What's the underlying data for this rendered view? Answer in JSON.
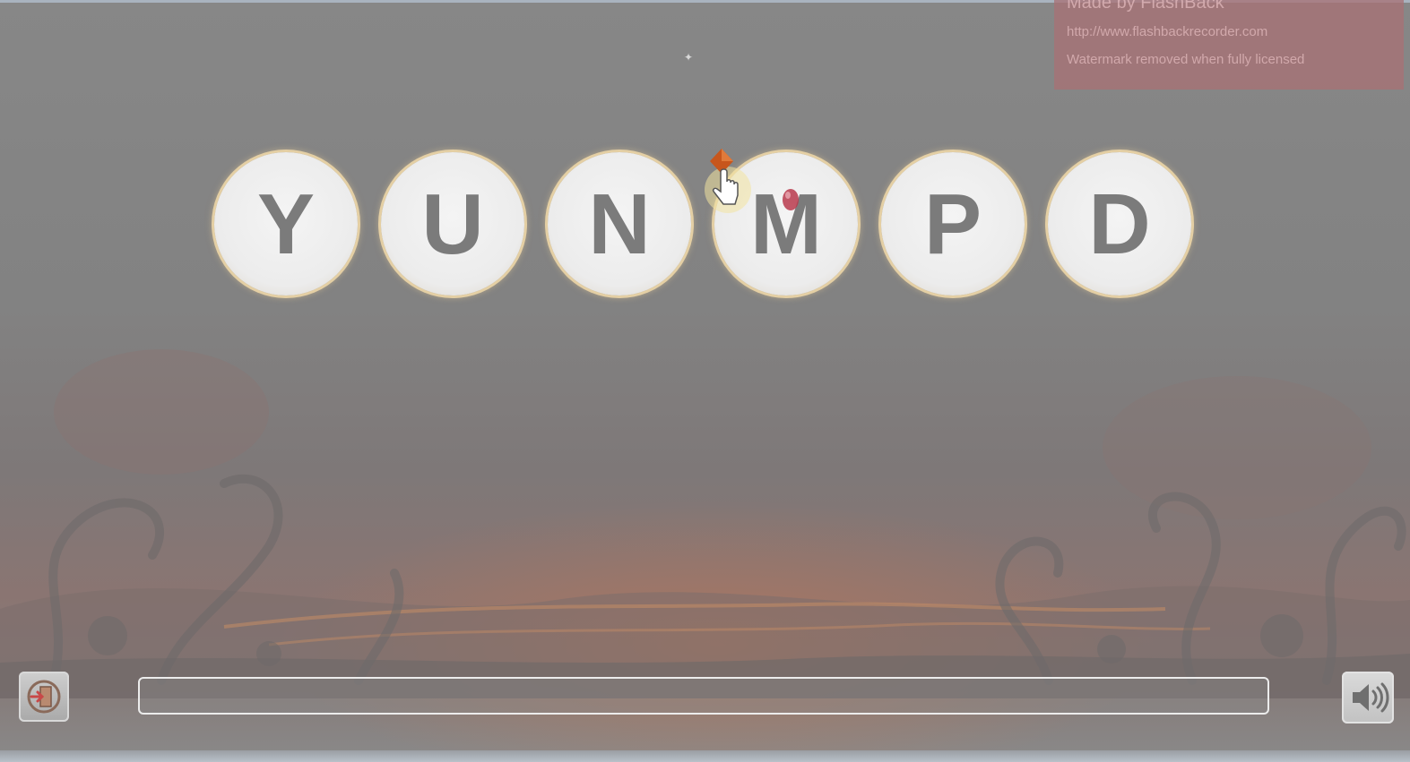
{
  "watermark": {
    "title": "Made by FlashBack",
    "url": "http://www.flashbackrecorder.com",
    "note": "Watermark removed when fully licensed"
  },
  "letters": [
    "Y",
    "U",
    "N",
    "M",
    "P",
    "D"
  ],
  "progress": {
    "value": 0
  },
  "controls": {
    "exit_icon": "exit-door-icon",
    "sound_icon": "speaker-icon"
  },
  "colors": {
    "bubble_fill": "#eeeeee",
    "bubble_ring": "#e4cfa4",
    "letter": "#7b7b7b",
    "watermark_bg": "#a87074",
    "progress_border": "#ececec"
  }
}
